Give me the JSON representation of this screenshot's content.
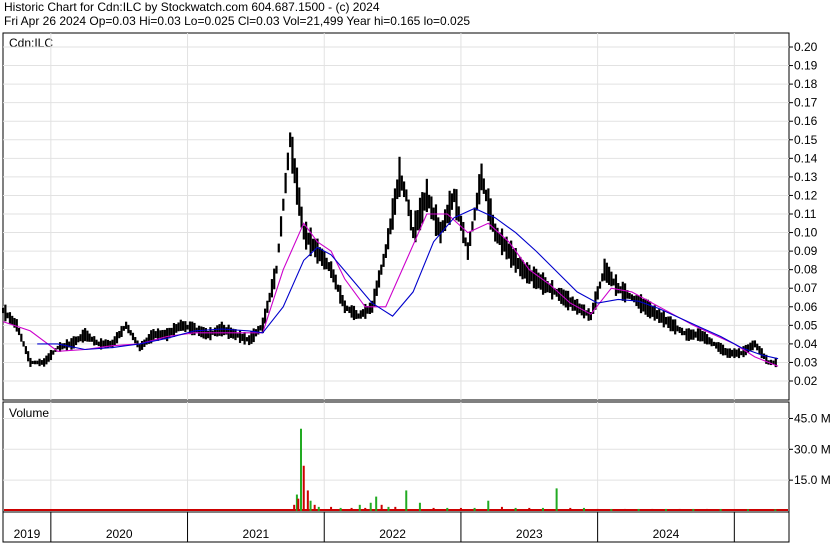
{
  "header": {
    "title": "Historic Chart for Cdn:ILC by Stockwatch.com 604.687.1500 - (c) 2024",
    "summary": "Fri Apr 26 2024   Op=0.03   Hi=0.03   Lo=0.025   Cl=0.03   Vol=21,499   Year hi=0.165   lo=0.025"
  },
  "chart_data": [
    {
      "type": "line",
      "title": "Cdn:ILC",
      "ylim": [
        0.01,
        0.205
      ],
      "y_ticks": [
        "0.20",
        "0.19",
        "0.18",
        "0.17",
        "0.16",
        "0.15",
        "0.14",
        "0.13",
        "0.12",
        "0.11",
        "0.10",
        "0.09",
        "0.08",
        "0.07",
        "0.06",
        "0.05",
        "0.04",
        "0.03",
        "0.02"
      ],
      "x_ticks": [
        "2019",
        "2020",
        "2021",
        "2022",
        "2023",
        "2024"
      ],
      "x_tick_values": [
        2019.0,
        2020.0,
        2021.0,
        2022.0,
        2023.0,
        2024.0
      ],
      "xlim": [
        2018.65,
        2024.4
      ],
      "grid": true,
      "price": {
        "x": [
          2018.65,
          2018.75,
          2018.85,
          2018.95,
          2019.05,
          2019.15,
          2019.25,
          2019.35,
          2019.45,
          2019.55,
          2019.65,
          2019.75,
          2019.85,
          2019.95,
          2020.05,
          2020.15,
          2020.25,
          2020.35,
          2020.45,
          2020.55,
          2020.65,
          2020.75,
          2020.85,
          2020.9,
          2020.95,
          2021.0,
          2021.05,
          2021.1,
          2021.15,
          2021.25,
          2021.35,
          2021.45,
          2021.55,
          2021.6,
          2021.65,
          2021.75,
          2021.85,
          2021.95,
          2022.05,
          2022.15,
          2022.25,
          2022.35,
          2022.45,
          2022.55,
          2022.65,
          2022.75,
          2022.85,
          2022.95,
          2023.05,
          2023.15,
          2023.25,
          2023.35,
          2023.45,
          2023.55,
          2023.65,
          2023.75,
          2023.85,
          2023.95,
          2024.05,
          2024.15,
          2024.25,
          2024.32
        ],
        "y": [
          0.058,
          0.05,
          0.03,
          0.03,
          0.038,
          0.04,
          0.045,
          0.04,
          0.04,
          0.05,
          0.038,
          0.045,
          0.045,
          0.05,
          0.048,
          0.045,
          0.048,
          0.045,
          0.042,
          0.05,
          0.08,
          0.15,
          0.1,
          0.095,
          0.09,
          0.085,
          0.08,
          0.07,
          0.06,
          0.055,
          0.06,
          0.09,
          0.13,
          0.12,
          0.1,
          0.12,
          0.1,
          0.12,
          0.09,
          0.13,
          0.1,
          0.09,
          0.08,
          0.075,
          0.07,
          0.065,
          0.06,
          0.055,
          0.08,
          0.07,
          0.065,
          0.06,
          0.055,
          0.05,
          0.045,
          0.045,
          0.04,
          0.035,
          0.035,
          0.04,
          0.03,
          0.03
        ]
      },
      "series": [
        {
          "name": "",
          "color": "#cc00cc",
          "x": [
            2018.65,
            2018.85,
            2019.05,
            2019.25,
            2019.45,
            2019.65,
            2019.85,
            2020.05,
            2020.25,
            2020.45,
            2020.55,
            2020.7,
            2020.85,
            2020.95,
            2021.05,
            2021.15,
            2021.3,
            2021.45,
            2021.6,
            2021.75,
            2021.9,
            2022.05,
            2022.2,
            2022.35,
            2022.5,
            2022.65,
            2022.8,
            2022.95,
            2023.1,
            2023.25,
            2023.4,
            2023.55,
            2023.7,
            2023.85,
            2024.0,
            2024.15,
            2024.32
          ],
          "y": [
            0.052,
            0.047,
            0.036,
            0.037,
            0.039,
            0.04,
            0.044,
            0.046,
            0.046,
            0.046,
            0.046,
            0.08,
            0.105,
            0.095,
            0.09,
            0.075,
            0.06,
            0.06,
            0.085,
            0.11,
            0.11,
            0.1,
            0.105,
            0.095,
            0.08,
            0.072,
            0.062,
            0.056,
            0.07,
            0.068,
            0.062,
            0.056,
            0.05,
            0.045,
            0.04,
            0.033,
            0.028
          ]
        },
        {
          "name": "",
          "color": "#0000cc",
          "x": [
            2018.9,
            2019.05,
            2019.25,
            2019.45,
            2019.65,
            2019.85,
            2020.05,
            2020.25,
            2020.45,
            2020.55,
            2020.7,
            2020.85,
            2020.95,
            2021.05,
            2021.2,
            2021.35,
            2021.5,
            2021.65,
            2021.8,
            2021.95,
            2022.1,
            2022.25,
            2022.4,
            2022.55,
            2022.7,
            2022.85,
            2023.0,
            2023.15,
            2023.3,
            2023.45,
            2023.6,
            2023.75,
            2023.9,
            2024.05,
            2024.2,
            2024.32
          ],
          "y": [
            0.04,
            0.04,
            0.037,
            0.038,
            0.04,
            0.043,
            0.047,
            0.048,
            0.047,
            0.046,
            0.06,
            0.085,
            0.092,
            0.088,
            0.075,
            0.062,
            0.055,
            0.068,
            0.095,
            0.108,
            0.113,
            0.108,
            0.1,
            0.09,
            0.079,
            0.068,
            0.062,
            0.064,
            0.063,
            0.059,
            0.054,
            0.049,
            0.044,
            0.038,
            0.034,
            0.032
          ]
        }
      ]
    },
    {
      "type": "bar",
      "title": "Volume",
      "y_ticks": [
        "45.0 M",
        "30.0 M",
        "15.0 M"
      ],
      "ylim": [
        0,
        53
      ],
      "bars": {
        "x": [
          2020.78,
          2020.8,
          2020.81,
          2020.83,
          2020.85,
          2020.88,
          2020.9,
          2020.93,
          2020.96,
          2021.05,
          2021.12,
          2021.2,
          2021.26,
          2021.3,
          2021.34,
          2021.38,
          2021.42,
          2021.47,
          2021.52,
          2021.6,
          2021.7,
          2021.8,
          2021.9,
          2022.0,
          2022.1,
          2022.2,
          2022.3,
          2022.4,
          2022.5,
          2022.6,
          2022.7,
          2022.8,
          2022.9,
          2023.0,
          2023.1,
          2023.2,
          2023.3,
          2023.4,
          2023.5,
          2023.6,
          2023.7,
          2023.8,
          2023.9,
          2024.0,
          2024.1,
          2024.2,
          2024.3
        ],
        "values": [
          3,
          8,
          6,
          40,
          22,
          10,
          5,
          3,
          2,
          2,
          1.5,
          1.5,
          3,
          1.5,
          4,
          7,
          3,
          2,
          2,
          10,
          4,
          1.5,
          1.5,
          1.5,
          1.5,
          5,
          2,
          1.5,
          1.5,
          1.5,
          11,
          1.5,
          1.5,
          1,
          1,
          1,
          1,
          1,
          1,
          1,
          1,
          1,
          1,
          0.8,
          0.8,
          0.8,
          0.8
        ],
        "colors": [
          "#cc0000",
          "#22aa22",
          "#cc0000",
          "#22aa22",
          "#cc0000",
          "#cc0000",
          "#22aa22",
          "#cc0000",
          "#22aa22",
          "#cc0000",
          "#22aa22",
          "#cc0000",
          "#22aa22",
          "#cc0000",
          "#22aa22",
          "#22aa22",
          "#cc0000",
          "#22aa22",
          "#cc0000",
          "#22aa22",
          "#22aa22",
          "#cc0000",
          "#22aa22",
          "#cc0000",
          "#22aa22",
          "#22aa22",
          "#cc0000",
          "#22aa22",
          "#cc0000",
          "#22aa22",
          "#22aa22",
          "#cc0000",
          "#22aa22",
          "#cc0000",
          "#22aa22",
          "#cc0000",
          "#22aa22",
          "#cc0000",
          "#22aa22",
          "#cc0000",
          "#22aa22",
          "#cc0000",
          "#22aa22",
          "#cc0000",
          "#22aa22",
          "#cc0000",
          "#22aa22"
        ]
      }
    }
  ]
}
